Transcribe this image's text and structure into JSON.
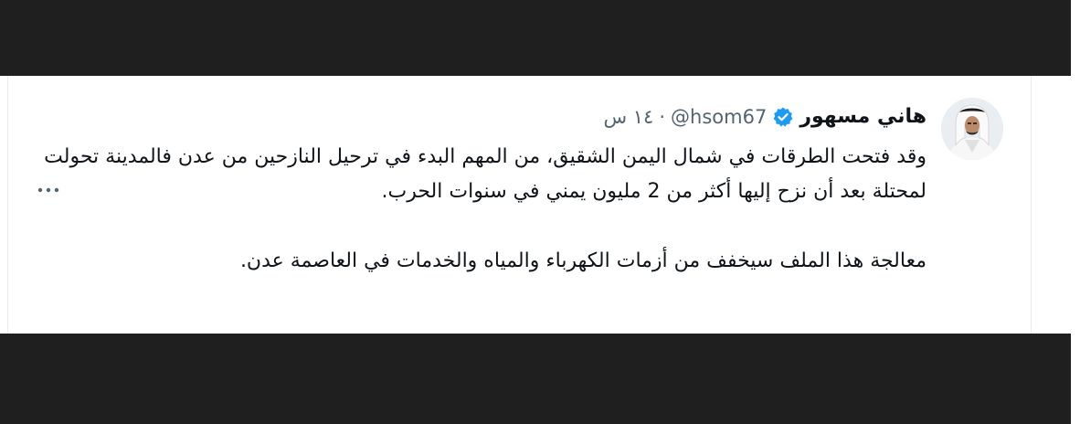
{
  "tweet": {
    "author_name": "هاني مسهور",
    "handle": "@hsom67",
    "separator": "·",
    "time": "١٤ س",
    "paragraph_1": "وقد فتحت الطرقات في شمال اليمن الشقيق، من المهم البدء في ترحيل النازحين من عدن فالمدينة تحولت لمحتلة بعد أن نزح إليها أكثر من 2 مليون يمني في سنوات الحرب.",
    "paragraph_2": "معالجة هذا الملف سيخفف من أزمات الكهرباء والمياه والخدمات في العاصمة عدن."
  },
  "icons": {
    "verified": "verified-badge-icon",
    "more": "more-options-icon"
  },
  "colors": {
    "background_dark": "#1f1f1f",
    "card": "#ffffff",
    "text": "#0f1419",
    "muted": "#536471",
    "verified": "#1d9bf0"
  }
}
